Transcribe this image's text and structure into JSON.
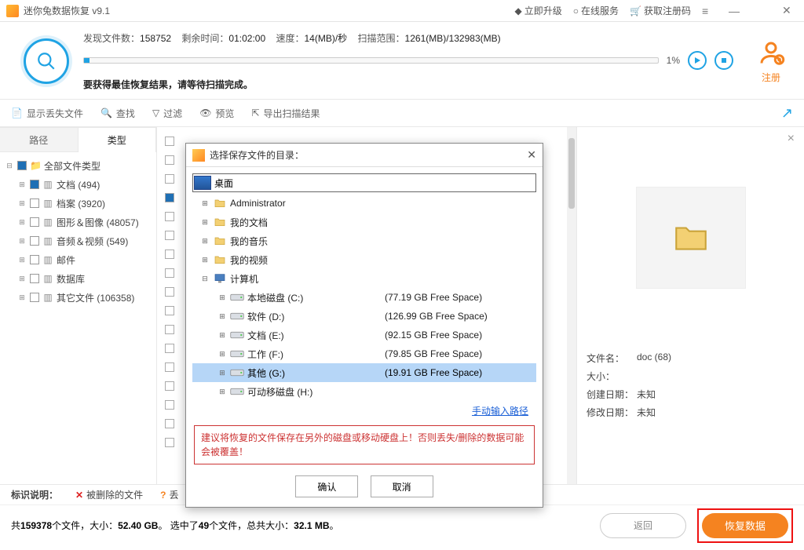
{
  "titlebar": {
    "title": "迷你兔数据恢复 v9.1",
    "upgrade": "立即升级",
    "online": "在线服务",
    "regcode": "获取注册码"
  },
  "scan": {
    "found_label": "发现文件数：",
    "found_value": "158752",
    "remain_label": "剩余时间：",
    "remain_value": "01:02:00",
    "speed_label": "速度：",
    "speed_value": "14(MB)/秒",
    "range_label": "扫描范围：",
    "range_value": "1261(MB)/132983(MB)",
    "percent": "1%",
    "tip": "要获得最佳恢复结果，请等待扫描完成。",
    "register": "注册"
  },
  "toolbar": {
    "show_lost": "显示丢失文件",
    "find": "查找",
    "filter": "过滤",
    "preview": "预览",
    "export": "导出扫描结果"
  },
  "tabs": {
    "path": "路径",
    "type": "类型"
  },
  "tree": {
    "root": "全部文件类型",
    "items": [
      "文档 (494)",
      "档案 (3920)",
      "图形＆图像 (48057)",
      "音频＆视频 (549)",
      "邮件",
      "数据库",
      "其它文件 (106358)"
    ]
  },
  "dialog": {
    "title": "选择保存文件的目录：",
    "desktop": "桌面",
    "rows": [
      {
        "d": 1,
        "lbl": "Administrator",
        "free": "",
        "exp": "⊞",
        "t": "folder"
      },
      {
        "d": 1,
        "lbl": "我的文档",
        "free": "",
        "exp": "⊞",
        "t": "folder"
      },
      {
        "d": 1,
        "lbl": "我的音乐",
        "free": "",
        "exp": "⊞",
        "t": "folder"
      },
      {
        "d": 1,
        "lbl": "我的视频",
        "free": "",
        "exp": "⊞",
        "t": "folder"
      },
      {
        "d": 1,
        "lbl": "计算机",
        "free": "",
        "exp": "⊟",
        "t": "computer"
      },
      {
        "d": 2,
        "lbl": "本地磁盘 (C:)",
        "free": "(77.19 GB Free Space)",
        "exp": "⊞",
        "t": "drive"
      },
      {
        "d": 2,
        "lbl": "软件 (D:)",
        "free": "(126.99 GB Free Space)",
        "exp": "⊞",
        "t": "drive"
      },
      {
        "d": 2,
        "lbl": "文档 (E:)",
        "free": "(92.15 GB Free Space)",
        "exp": "⊞",
        "t": "drive"
      },
      {
        "d": 2,
        "lbl": "工作 (F:)",
        "free": "(79.85 GB Free Space)",
        "exp": "⊞",
        "t": "drive"
      },
      {
        "d": 2,
        "lbl": "其他 (G:)",
        "free": "(19.91 GB Free Space)",
        "exp": "⊞",
        "t": "drive",
        "sel": true
      },
      {
        "d": 2,
        "lbl": "可动移磁盘 (H:)",
        "free": "",
        "exp": "⊞",
        "t": "drive"
      }
    ],
    "manual": "手动输入路径",
    "warning": "建议将恢复的文件保存在另外的磁盘或移动硬盘上！否则丢失/删除的数据可能会被覆盖！",
    "ok": "确认",
    "cancel": "取消"
  },
  "preview": {
    "name_lbl": "文件名：",
    "name_val": "doc (68)",
    "size_lbl": "大小：",
    "size_val": "",
    "cdate_lbl": "创建日期：",
    "cdate_val": "未知",
    "mdate_lbl": "修改日期：",
    "mdate_val": "未知"
  },
  "legend": {
    "label": "标识说明：",
    "deleted": "被删除的文件",
    "lost_prefix": "丢"
  },
  "status": {
    "text_a": "共",
    "count": "159378",
    "text_b": "个文件，大小：",
    "total_size": "52.40 GB",
    "text_c": "。 选中了",
    "sel_count": "49",
    "text_d": "个文件，总共大小：",
    "sel_size": "32.1 MB",
    "tail": "。",
    "back": "返回",
    "recover": "恢复数据"
  }
}
